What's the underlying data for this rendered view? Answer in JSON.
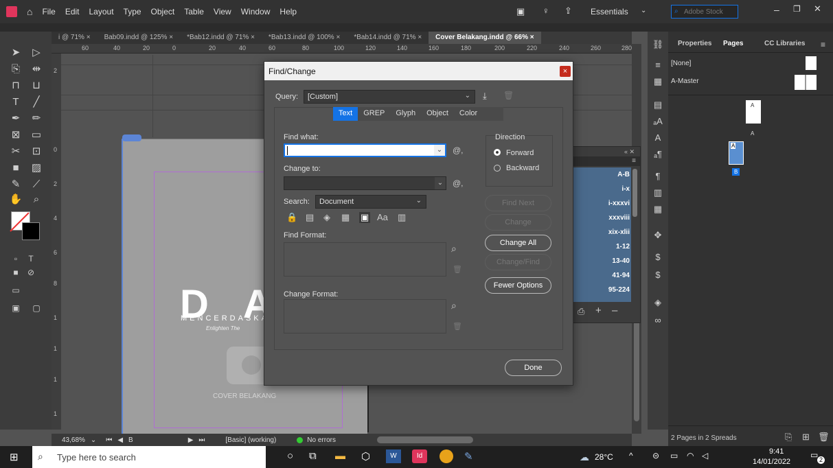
{
  "menubar": {
    "items": [
      "File",
      "Edit",
      "Layout",
      "Type",
      "Object",
      "Table",
      "View",
      "Window",
      "Help"
    ],
    "workspace": "Essentials",
    "search_placeholder": "Adobe Stock"
  },
  "tabs": [
    "i @ 71% ×",
    "Bab09.indd @ 125% ×",
    "*Bab12.indd @ 71% ×",
    "*Bab13.indd @ 100% ×",
    "*Bab14.indd @ 71% ×",
    "Cover Belakang.indd @ 66% ×"
  ],
  "ruler": [
    "60",
    "40",
    "20",
    "0",
    "20",
    "40",
    "60",
    "80",
    "100",
    "120",
    "140",
    "160",
    "180",
    "200",
    "220",
    "240",
    "260",
    "280"
  ],
  "vruler": [
    "2",
    "0",
    "2",
    "4",
    "6",
    "8",
    "1",
    "1",
    "1",
    "1",
    "1"
  ],
  "canvas": {
    "big_text": "D A T",
    "sub_text": "MENCERDASKAN",
    "tagline": "Enlighten The",
    "camera_caption": "COVER BELAKANG"
  },
  "statusbar": {
    "zoom": "43,68%",
    "page": "B",
    "style": "[Basic] (working)",
    "errors": "No errors"
  },
  "pages_panel": {
    "tabs": [
      "Properties",
      "Pages",
      "CC Libraries"
    ],
    "none_label": "[None]",
    "master_label": "A-Master",
    "page_letters": [
      "A",
      "A",
      "A",
      "B"
    ],
    "footer": "2 Pages in 2 Spreads"
  },
  "page_list": [
    "A-B",
    "i-x",
    "i-xxxvi",
    "xxxviii",
    "xix-xlii",
    "1-12",
    "13-40",
    "41-94",
    "95-224"
  ],
  "dialog": {
    "title": "Find/Change",
    "query_label": "Query:",
    "query_value": "[Custom]",
    "tabs": [
      "Text",
      "GREP",
      "Glyph",
      "Object",
      "Color"
    ],
    "find_what_label": "Find what:",
    "find_what_value": "",
    "change_to_label": "Change to:",
    "change_to_value": "",
    "search_label": "Search:",
    "search_value": "Document",
    "direction_label": "Direction",
    "forward": "Forward",
    "backward": "Backward",
    "find_format_label": "Find Format:",
    "change_format_label": "Change Format:",
    "buttons": {
      "find_next": "Find Next",
      "change": "Change",
      "change_all": "Change All",
      "change_find": "Change/Find",
      "fewer_options": "Fewer Options",
      "done": "Done"
    },
    "at_symbol": "@,",
    "aa": "Aa"
  },
  "taskbar": {
    "search_placeholder": "Type here to search",
    "weather": "28°C",
    "time": "9:41",
    "date": "14/01/2022",
    "notifications": "2"
  },
  "colors": {
    "accent": "#1473e6",
    "close": "#c42b1c",
    "id_logo": "#e0355c"
  }
}
